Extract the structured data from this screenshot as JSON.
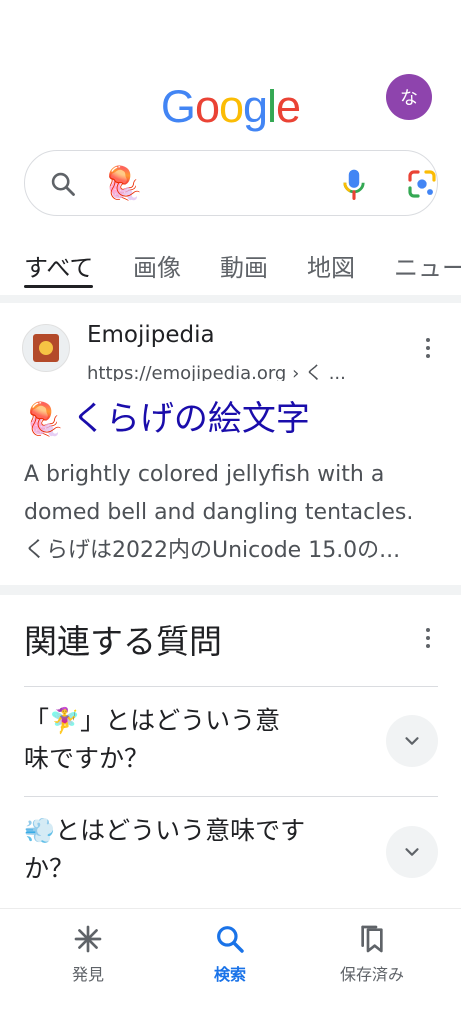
{
  "header": {
    "logo_letters": [
      "G",
      "o",
      "o",
      "g",
      "l",
      "e"
    ],
    "logo_colors": [
      "#4285F4",
      "#EA4335",
      "#FBBC05",
      "#4285F4",
      "#34A853",
      "#EA4335"
    ],
    "avatar_initial": "な",
    "avatar_color": "#8e44ad"
  },
  "search": {
    "query": "🪼",
    "icons": [
      "search-icon",
      "mic-icon",
      "lens-icon"
    ]
  },
  "tabs": [
    {
      "label": "すべて",
      "active": true
    },
    {
      "label": "画像",
      "active": false
    },
    {
      "label": "動画",
      "active": false
    },
    {
      "label": "地図",
      "active": false
    },
    {
      "label": "ニュー",
      "active": false
    }
  ],
  "result": {
    "site_name": "Emojipedia",
    "url": "https://emojipedia.org › く ...",
    "title_emoji": "🪼",
    "title": "くらげの絵文字",
    "snippet_lines": [
      "A brightly colored jellyfish with a",
      "domed bell and dangling tentacles.",
      "くらげは2022内のUnicode 15.0の..."
    ]
  },
  "related": {
    "title": "関連する質問",
    "questions": [
      {
        "line1": "「🧚‍♀️」とはどういう意",
        "line2": "味ですか？"
      },
      {
        "line1": "💨とはどういう意味です",
        "line2": "か？"
      }
    ]
  },
  "bottom_nav": [
    {
      "label": "発見",
      "icon": "discover-icon",
      "active": false
    },
    {
      "label": "検索",
      "icon": "search-icon",
      "active": true
    },
    {
      "label": "保存済み",
      "icon": "saved-icon",
      "active": false
    }
  ],
  "colors": {
    "link_blue": "#1a0dab",
    "accent_blue": "#1a73e8"
  }
}
